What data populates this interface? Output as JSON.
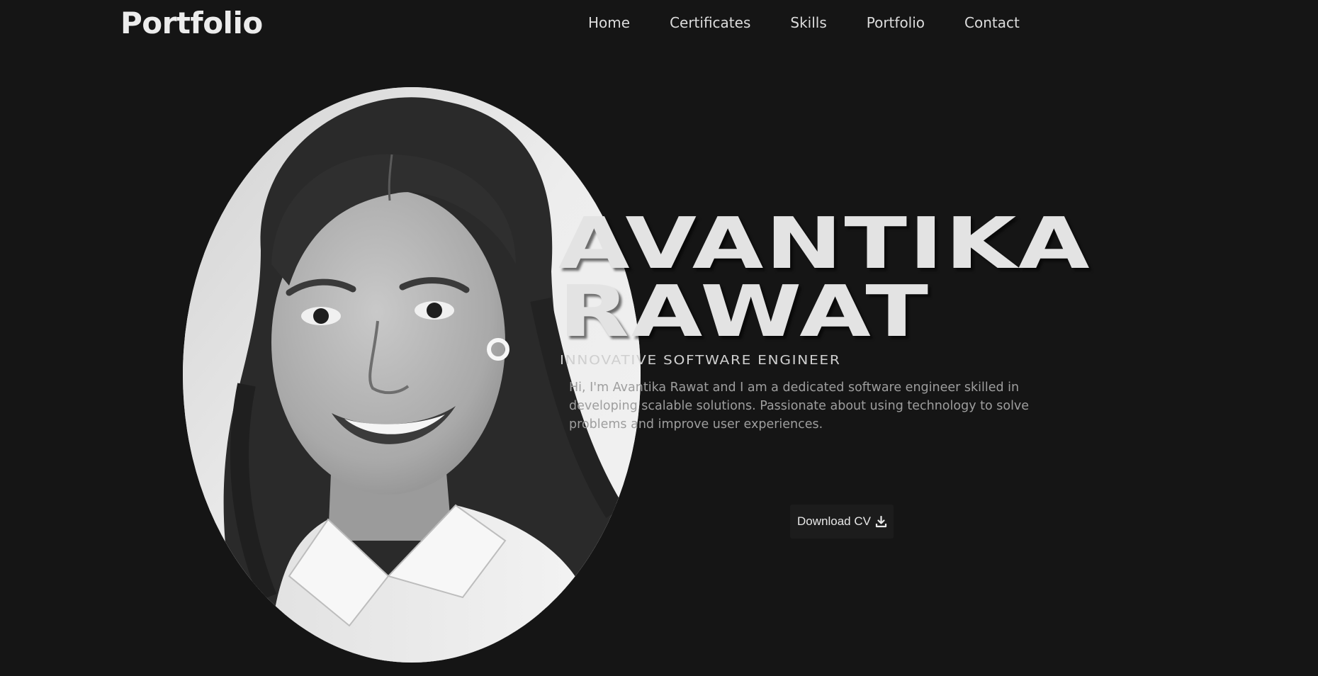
{
  "header": {
    "logo": "Portfolio",
    "nav": [
      "Home",
      "Certificates",
      "Skills",
      "Portfolio",
      "Contact"
    ]
  },
  "hero": {
    "name_line1": "AVANTIKA",
    "name_line2": "RAWAT",
    "tagline": "INNOVATIVE SOFTWARE ENGINEER",
    "bio": "Hi, I'm Avantika Rawat and I am a dedicated software engineer skilled in developing scalable solutions. Passionate about using technology to solve problems and improve user experiences.",
    "cv_button_label": "Download CV",
    "cv_button_icon": "download-icon"
  },
  "colors": {
    "background": "#151515",
    "text_primary": "#e3e3e3",
    "text_secondary": "#9e9e9e",
    "button_bg": "#1c1c1c"
  }
}
